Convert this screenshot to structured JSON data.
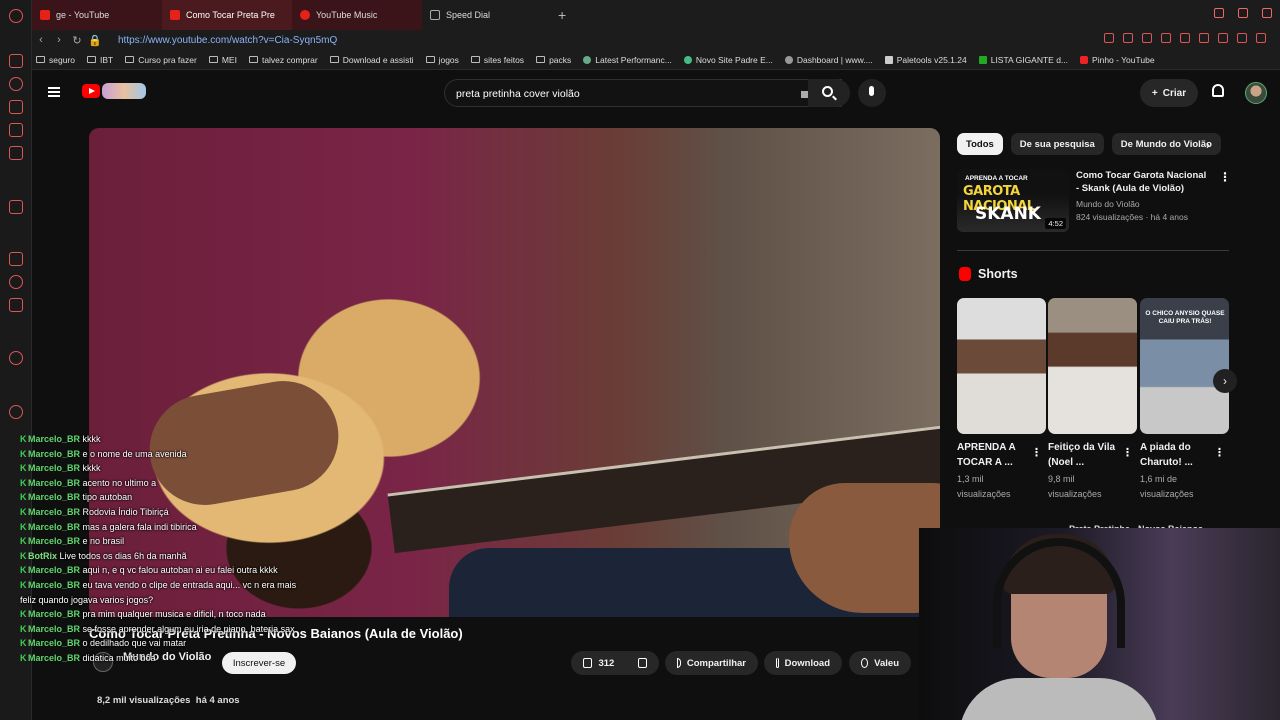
{
  "tabs": [
    {
      "label": "ge - YouTube"
    },
    {
      "label": "Como Tocar Preta Pre"
    },
    {
      "label": "YouTube Music"
    },
    {
      "label": "Speed Dial"
    }
  ],
  "address": {
    "url": "https://www.youtube.com/watch?v=Cia-Syqn5mQ"
  },
  "bookmarks": [
    "seguro",
    "IBT",
    "Curso pra fazer",
    "MEI",
    "talvez comprar",
    "Download e assisti",
    "jogos",
    "sites feitos",
    "packs",
    "Latest Performanc...",
    "Novo Site Padre E...",
    "Dashboard | www....",
    "Paletools v25.1.24",
    "LISTA GIGANTE d...",
    "Pinho - YouTube"
  ],
  "search": {
    "query": "preta pretinha cover violão"
  },
  "header": {
    "create_label": "Criar"
  },
  "video": {
    "title": "Como Tocar Preta Pretinha - Novos Baianos (Aula de Violão)",
    "channel": "Mundo do Violão",
    "subscribe_label": "Inscrever-se",
    "likes": "312",
    "share_label": "Compartilhar",
    "download_label": "Download",
    "thanks_label": "Valeu",
    "views": "8,2 mil visualizações",
    "age": "há 4 anos"
  },
  "chat": [
    {
      "user": "Marcelo_BR",
      "text": "kkkk"
    },
    {
      "user": "Marcelo_BR",
      "text": "e o nome de uma avenida"
    },
    {
      "user": "Marcelo_BR",
      "text": "kkkk"
    },
    {
      "user": "Marcelo_BR",
      "text": "acento no ultimo a"
    },
    {
      "user": "Marcelo_BR",
      "text": "tipo autoban"
    },
    {
      "user": "Marcelo_BR",
      "text": "Rodovia Índio Tibiriçá"
    },
    {
      "user": "Marcelo_BR",
      "text": "mas a galera fala indi tibirica"
    },
    {
      "user": "Marcelo_BR",
      "text": "e no brasil"
    },
    {
      "user": "BotRix",
      "text": "Live todos os dias 6h da manhã"
    },
    {
      "user": "Marcelo_BR",
      "text": "aqui n, e q vc falou autoban ai eu falei outra kkkk"
    },
    {
      "user": "Marcelo_BR",
      "text": "eu tava vendo o clipe de entrada aqui... vc n era mais feliz quando jogava varios jogos?"
    },
    {
      "user": "Marcelo_BR",
      "text": "pra mim qualquer musica e dificil, n toco nada"
    },
    {
      "user": "Marcelo_BR",
      "text": "se fosse aprender algum eu iria de piano, bateria sax"
    },
    {
      "user": "Marcelo_BR",
      "text": "o dedilhado que vai matar"
    },
    {
      "user": "Marcelo_BR",
      "text": "didatica muito boa"
    }
  ],
  "chips": [
    "Todos",
    "De sua pesquisa",
    "De Mundo do Violão"
  ],
  "recommendation": {
    "thumb_line1": "APRENDA A TOCAR",
    "thumb_line2": "GAROTA NACIONAL",
    "thumb_line3": "SKANK",
    "duration": "4:52",
    "title": "Como Tocar Garota Nacional - Skank (Aula de Violão)",
    "channel": "Mundo do Violão",
    "meta": "824 visualizações · há 4 anos"
  },
  "shorts": {
    "heading": "Shorts",
    "items": [
      {
        "title": "APRENDA A TOCAR A ...",
        "views": "1,3 mil visualizações"
      },
      {
        "title": "Feitiço da Vila (Noel ...",
        "views": "9,8 mil visualizações"
      },
      {
        "title": "A piada do Charuto! ...",
        "views": "1,6 mi de visualizações",
        "thumb_text": "O CHICO ANYSIO QUASE CAIU PRA TRÁS!"
      }
    ]
  },
  "next_peek": "Preta Pretinha - Novos Baianos",
  "colors": {
    "accent": "#ff0000",
    "chat_user": "#5fd66d",
    "background": "#0f0f0f"
  }
}
